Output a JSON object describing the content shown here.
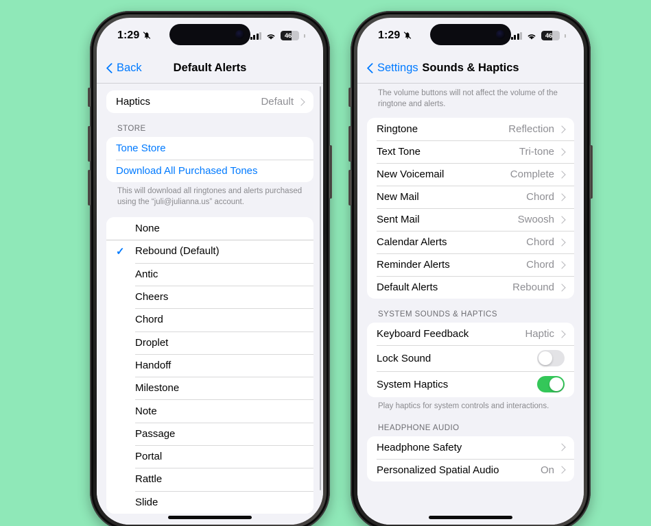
{
  "background_color": "#8FE8B8",
  "accent_color": "#007AFF",
  "toggle_on_color": "#34C759",
  "left_phone": {
    "status_bar": {
      "time": "1:29",
      "silent_icon": "bell-slash-icon",
      "cellular_icon": "cellular-bars-icon",
      "wifi_icon": "wifi-icon",
      "battery_percent": "46"
    },
    "nav": {
      "back_label": "Back",
      "title": "Default Alerts"
    },
    "haptics_group": {
      "rows": [
        {
          "label": "Haptics",
          "value": "Default"
        }
      ]
    },
    "store_section": {
      "header": "STORE",
      "rows": [
        {
          "label": "Tone Store"
        },
        {
          "label": "Download All Purchased Tones"
        }
      ],
      "footnote": "This will download all ringtones and alerts purchased using the “juli@julianna.us” account."
    },
    "tones": {
      "none_label": "None",
      "items": [
        {
          "label": "Rebound (Default)",
          "selected": true
        },
        {
          "label": "Antic",
          "selected": false
        },
        {
          "label": "Cheers",
          "selected": false
        },
        {
          "label": "Chord",
          "selected": false
        },
        {
          "label": "Droplet",
          "selected": false
        },
        {
          "label": "Handoff",
          "selected": false
        },
        {
          "label": "Milestone",
          "selected": false
        },
        {
          "label": "Note",
          "selected": false
        },
        {
          "label": "Passage",
          "selected": false
        },
        {
          "label": "Portal",
          "selected": false
        },
        {
          "label": "Rattle",
          "selected": false
        },
        {
          "label": "Slide",
          "selected": false
        }
      ]
    }
  },
  "right_phone": {
    "status_bar": {
      "time": "1:29",
      "silent_icon": "bell-slash-icon",
      "cellular_icon": "cellular-bars-icon",
      "wifi_icon": "wifi-icon",
      "battery_percent": "46"
    },
    "nav": {
      "back_label": "Settings",
      "title": "Sounds & Haptics"
    },
    "top_note": "The volume buttons will not affect the volume of the ringtone and alerts.",
    "sounds_group": {
      "rows": [
        {
          "label": "Ringtone",
          "value": "Reflection"
        },
        {
          "label": "Text Tone",
          "value": "Tri-tone"
        },
        {
          "label": "New Voicemail",
          "value": "Complete"
        },
        {
          "label": "New Mail",
          "value": "Chord"
        },
        {
          "label": "Sent Mail",
          "value": "Swoosh"
        },
        {
          "label": "Calendar Alerts",
          "value": "Chord"
        },
        {
          "label": "Reminder Alerts",
          "value": "Chord"
        },
        {
          "label": "Default Alerts",
          "value": "Rebound"
        }
      ]
    },
    "system_section": {
      "header": "SYSTEM SOUNDS & HAPTICS",
      "rows": [
        {
          "label": "Keyboard Feedback",
          "value": "Haptic",
          "type": "link"
        },
        {
          "label": "Lock Sound",
          "type": "toggle",
          "on": false
        },
        {
          "label": "System Haptics",
          "type": "toggle",
          "on": true
        }
      ],
      "footnote": "Play haptics for system controls and interactions."
    },
    "headphone_section": {
      "header": "HEADPHONE AUDIO",
      "rows": [
        {
          "label": "Headphone Safety",
          "value": ""
        },
        {
          "label": "Personalized Spatial Audio",
          "value": "On"
        }
      ]
    }
  }
}
